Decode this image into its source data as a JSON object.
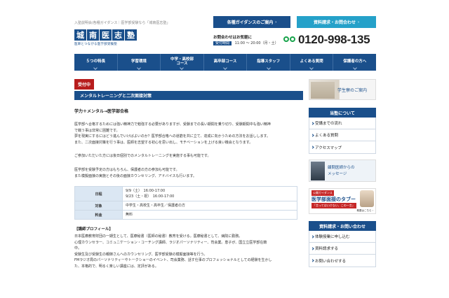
{
  "header": {
    "tagline": "入塾説明会/各種ガイダンス｜医学部受験なら「城南医志塾」",
    "logo_chars": [
      "城",
      "南",
      "医",
      "志",
      "塾"
    ],
    "logo_sub": "医師とつながる医学部受験塾",
    "guide_button": "各種ガイダンスのご案内",
    "request_button": "資料請求・お問合わせ",
    "contact_title": "お問合わせはお気軽に",
    "hours_label": "受付時間",
    "hours_value": "11:00 ～ 20:00（月・土）",
    "phone": "0120-998-135"
  },
  "nav": {
    "items": [
      {
        "label": "５つの特長"
      },
      {
        "label": "学習環境"
      },
      {
        "label": "中学・高校部\nコース"
      },
      {
        "label": "高卒部コース"
      },
      {
        "label": "指導スタッフ"
      },
      {
        "label": "よくある質問"
      },
      {
        "label": "保護者の方へ"
      }
    ]
  },
  "main": {
    "badge": "受付中",
    "seminar_title": "メンタルトレーニングと二次面接対策",
    "subheading": "学力＋メンタル→医学部合格",
    "para1": [
      "医学部へ合格するためには強い精神力で勉強する必要がありますが、受験までの長い期間を乗り切り、受験期間中も強い精神",
      "で戦う事は非常に困難です。",
      "夢を現実にするにはどう進んでいけばよいのか？医学部合格への道筋を共に立て、達成に向かうための方法をお話しします。",
      "また、二次面接対策を行う事は、医師を志望する初心を思い出し、モチベーションを上げる良い機会となります。"
    ],
    "para2": [
      "ご参加いただいた方には後日個別でのメンタルトレーニングを実施する事も可能です。"
    ],
    "para3": [
      "医学部を受験予定の方はもちろん、保護者の方の参加も可能です。",
      "また模擬面接の実施とその後の面接カウンセリング、アドバイスも行います。"
    ],
    "table": {
      "date_label": "日程",
      "date_values": [
        "9/9（土）　16:00-17:00",
        "9/23（土・祝）　16:00-17:00"
      ],
      "target_label": "対象",
      "target_value": "中学生・高校生・高卒生／保護者の方",
      "fee_label": "料金",
      "fee_value": "無料"
    },
    "profile_heading": "【講師プロフィール】",
    "profile": [
      "日本医療教育財団の一期生として、医療秘書（医師の秘書）教育を受ける。医療秘書として、病院に勤務。",
      "心理カウンセラー、コミュニケーション・コーチング講師、ラジオパーソナリティー、司会業。恵子が、国立立医学部在籍",
      "中。",
      "受験生及び受験生の親御さんへのカウンセリング、医学部受験の模擬面接等を行う。",
      "FMラジオ局のパーソナリティーやトークショーのイベント、司会業務、話す仕事のプロフェッショナルとしての経験を生かし",
      "た、本格的で、明るく楽しい講座には、定評がある。"
    ]
  },
  "sidebar": {
    "dorm_label": "学生寮のご案内",
    "about_heading": "当塾について",
    "about_items": [
      {
        "label": "受講までの流れ"
      },
      {
        "label": "よくある質問"
      },
      {
        "label": "アクセスマップ"
      }
    ],
    "message_lines": [
      "顧問医師からの",
      "メッセージ"
    ],
    "tafu_tag": "公開ガイダンス",
    "tafu_title": "医学部面接のタブー",
    "tafu_slogan": "「言ってはいけない、この一言」",
    "tafu_detail": "概要はこちら ›",
    "contact_heading": "資料請求・お問い合わせ",
    "contact_items": [
      {
        "label": "体験授業に申し込む"
      },
      {
        "label": "資料請求する"
      },
      {
        "label": "お問い合わせする"
      }
    ]
  },
  "colors": {
    "primary": "#1a4f8b",
    "accent": "#25a1c9",
    "badge": "#b71c1c",
    "table_header": "#dbe7f3"
  }
}
